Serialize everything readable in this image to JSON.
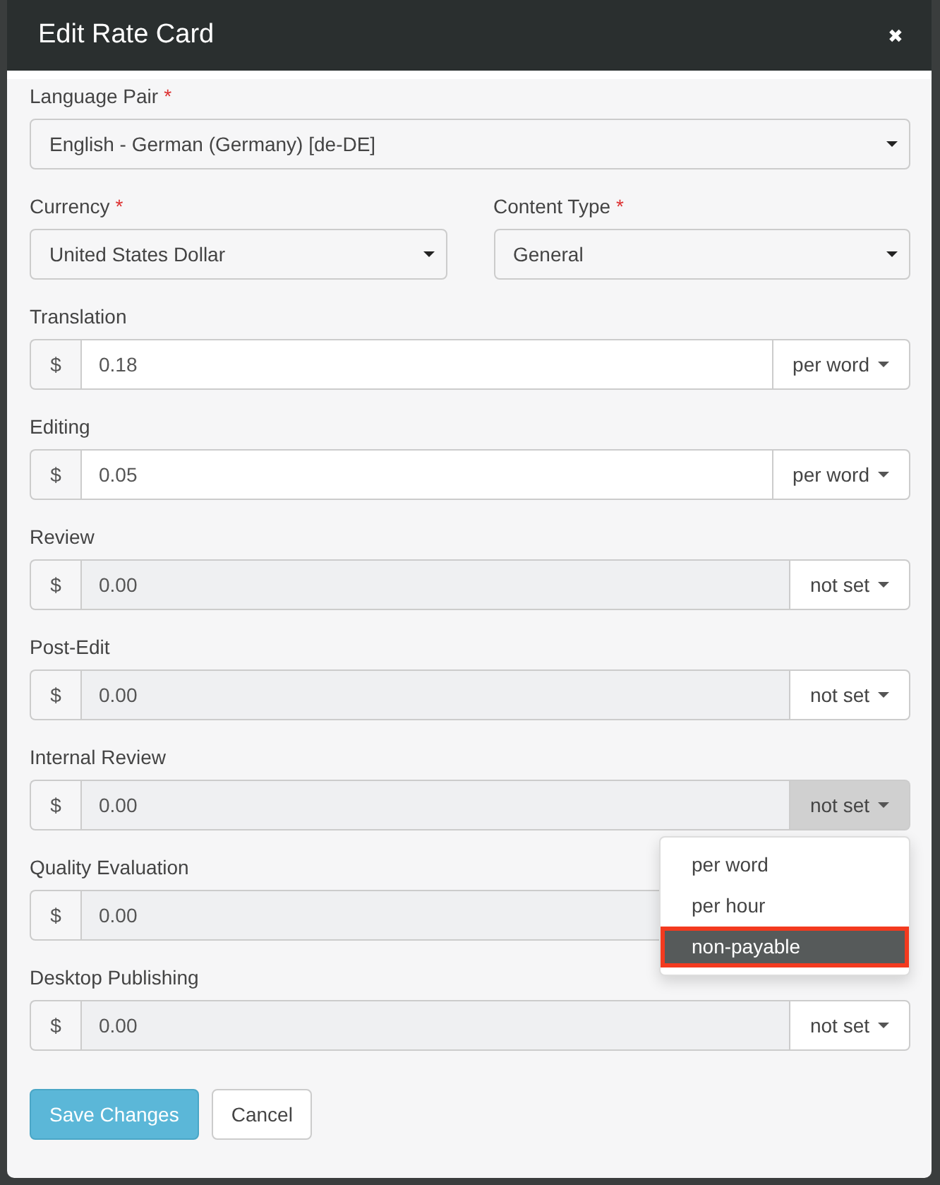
{
  "modal": {
    "title": "Edit Rate Card",
    "close": "✖"
  },
  "language_pair": {
    "label": "Language Pair",
    "required": "*",
    "value": "English - German (Germany) [de-DE]"
  },
  "currency": {
    "label": "Currency",
    "required": "*",
    "value": "United States Dollar"
  },
  "content_type": {
    "label": "Content Type",
    "required": "*",
    "value": "General"
  },
  "rates": [
    {
      "label": "Translation",
      "symbol": "$",
      "value": "0.18",
      "unit": "per word",
      "disabled": false
    },
    {
      "label": "Editing",
      "symbol": "$",
      "value": "0.05",
      "unit": "per word",
      "disabled": false
    },
    {
      "label": "Review",
      "symbol": "$",
      "value": "0.00",
      "unit": "not set",
      "disabled": true
    },
    {
      "label": "Post-Edit",
      "symbol": "$",
      "value": "0.00",
      "unit": "not set",
      "disabled": true
    },
    {
      "label": "Internal Review",
      "symbol": "$",
      "value": "0.00",
      "unit": "not set",
      "disabled": true,
      "open": true,
      "menu": [
        {
          "label": "per word",
          "selected": false
        },
        {
          "label": "per hour",
          "selected": false
        },
        {
          "label": "non-payable",
          "selected": true
        }
      ]
    },
    {
      "label": "Quality Evaluation",
      "symbol": "$",
      "value": "0.00",
      "disabled": true
    },
    {
      "label": "Desktop Publishing",
      "symbol": "$",
      "value": "0.00",
      "unit": "not set",
      "disabled": true
    }
  ],
  "buttons": [
    {
      "label": "Save Changes",
      "kind": "primary"
    },
    {
      "label": "Cancel",
      "kind": "default"
    }
  ]
}
